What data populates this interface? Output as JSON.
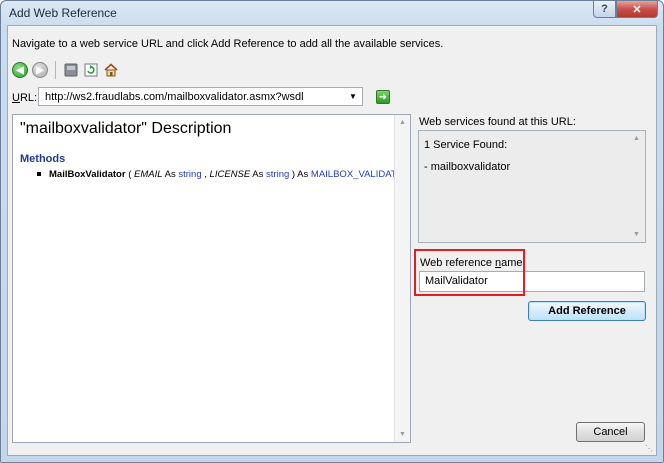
{
  "window": {
    "title": "Add Web Reference",
    "help_label": "?",
    "close_label": "✕"
  },
  "instructions": "Navigate to a web service URL and click Add Reference to add all the available services.",
  "toolbar": {
    "icons": [
      "back-icon",
      "forward-icon",
      "stop-icon",
      "refresh-icon",
      "home-icon"
    ]
  },
  "url": {
    "label_prefix": "U",
    "label_rest": "RL:",
    "value": "http://ws2.fraudlabs.com/mailboxvalidator.asmx?wsdl"
  },
  "description": {
    "title": "\"mailboxvalidator\" Description",
    "methods_heading": "Methods",
    "method": {
      "name": "MailBoxValidator",
      "open": " ( ",
      "param1_name": "EMAIL",
      "as1": " As ",
      "param1_type": "string",
      "sep": " ,  ",
      "param2_name": "LICENSE",
      "as2": " As ",
      "param2_type": "string",
      "close": " ) As ",
      "return_type": "MAILBOX_VALIDATOR"
    }
  },
  "services": {
    "label": "Web services found at this URL:",
    "count_text": "1 Service Found:",
    "item": "- mailboxvalidator"
  },
  "reference": {
    "label_before": "Web reference ",
    "label_key": "n",
    "label_after": "ame:",
    "value": "MailValidator"
  },
  "buttons": {
    "add_reference": "Add Reference",
    "cancel": "Cancel"
  },
  "colors": {
    "highlight": "#e02020",
    "link": "#1f3dbf",
    "heading": "#1f3d8a"
  }
}
